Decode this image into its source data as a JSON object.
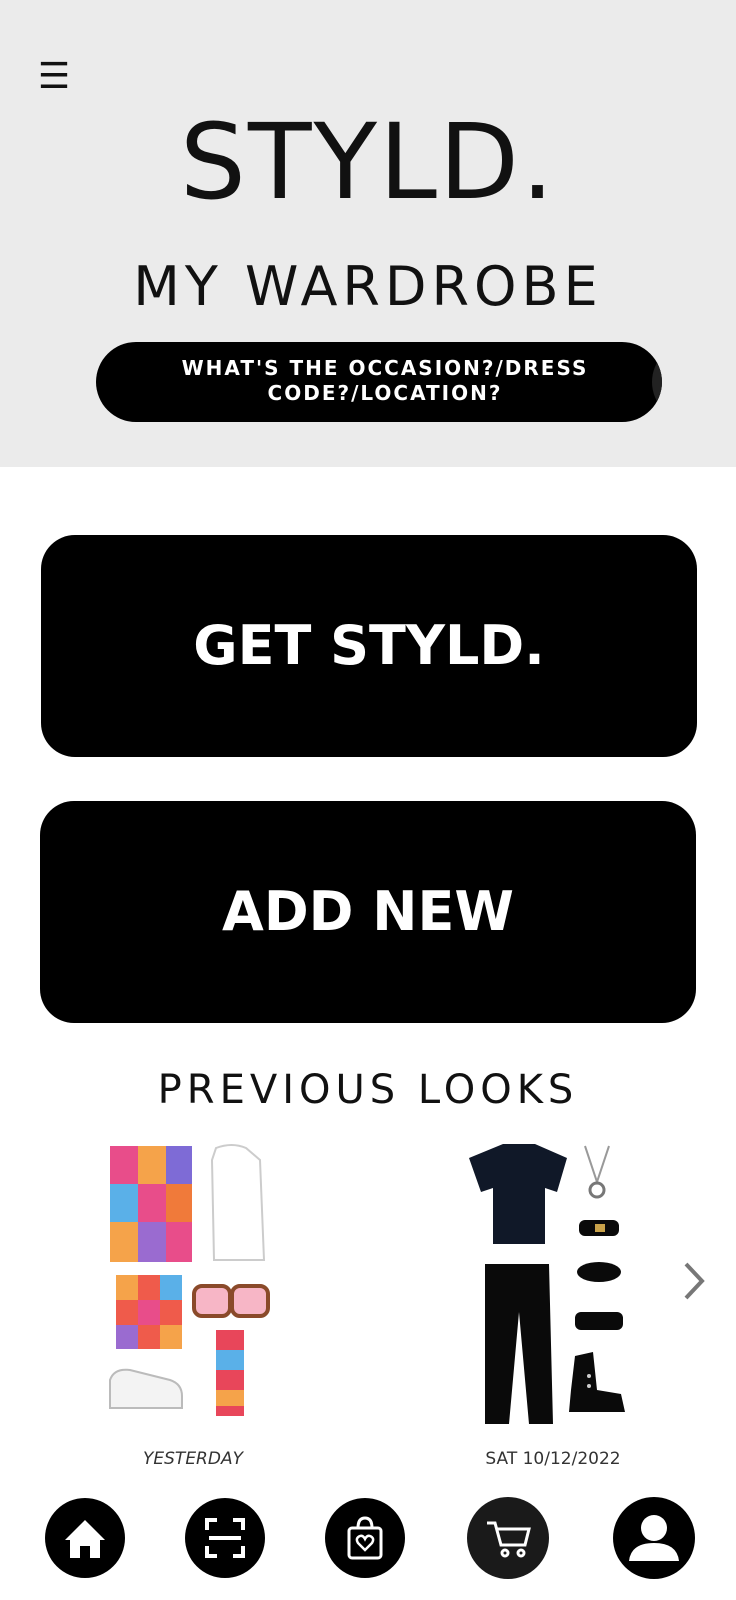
{
  "header": {
    "menu_icon": "☰",
    "brand": "STYLD.",
    "subtitle": "MY WARDROBE"
  },
  "search": {
    "line1": "WHAT'S THE OCCASION?/DRESS",
    "line2": "CODE?/LOCATION?"
  },
  "actions": {
    "get_styld": "GET STYLD.",
    "add_new": "ADD NEW"
  },
  "previous_looks": {
    "title": "PREVIOUS LOOKS",
    "items": [
      {
        "date": "YESTERDAY"
      },
      {
        "date": "SAT 10/12/2022"
      }
    ]
  },
  "bottom_nav": {
    "items": [
      "home-icon",
      "scan-icon",
      "shopping-bag-heart-icon",
      "cart-icon",
      "profile-icon"
    ]
  }
}
